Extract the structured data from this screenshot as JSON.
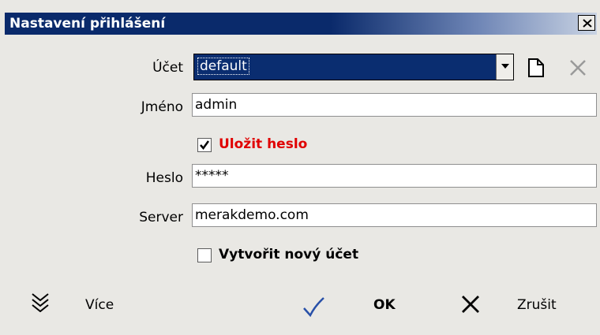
{
  "window": {
    "title": "Nastavení přihlášení"
  },
  "form": {
    "account": {
      "label": "Účet",
      "value": "default"
    },
    "name": {
      "label": "Jméno",
      "value": "admin"
    },
    "save_password": {
      "label": "Uložit heslo",
      "checked": true,
      "color": "#e00000"
    },
    "password": {
      "label": "Heslo",
      "value": "*****"
    },
    "server": {
      "label": "Server",
      "value": "merakdemo.com"
    },
    "create_account": {
      "label": "Vytvořit nový účet",
      "checked": false
    }
  },
  "buttons": {
    "more": {
      "label": "Více",
      "icon": "double-chevron-down-icon"
    },
    "ok": {
      "label": "OK",
      "icon": "checkmark-icon"
    },
    "cancel": {
      "label": "Zrušit",
      "icon": "close-icon"
    }
  },
  "colors": {
    "titlebar": "#0a2a6b",
    "selection": "#0a2d70",
    "background": "#e9e8e4"
  }
}
